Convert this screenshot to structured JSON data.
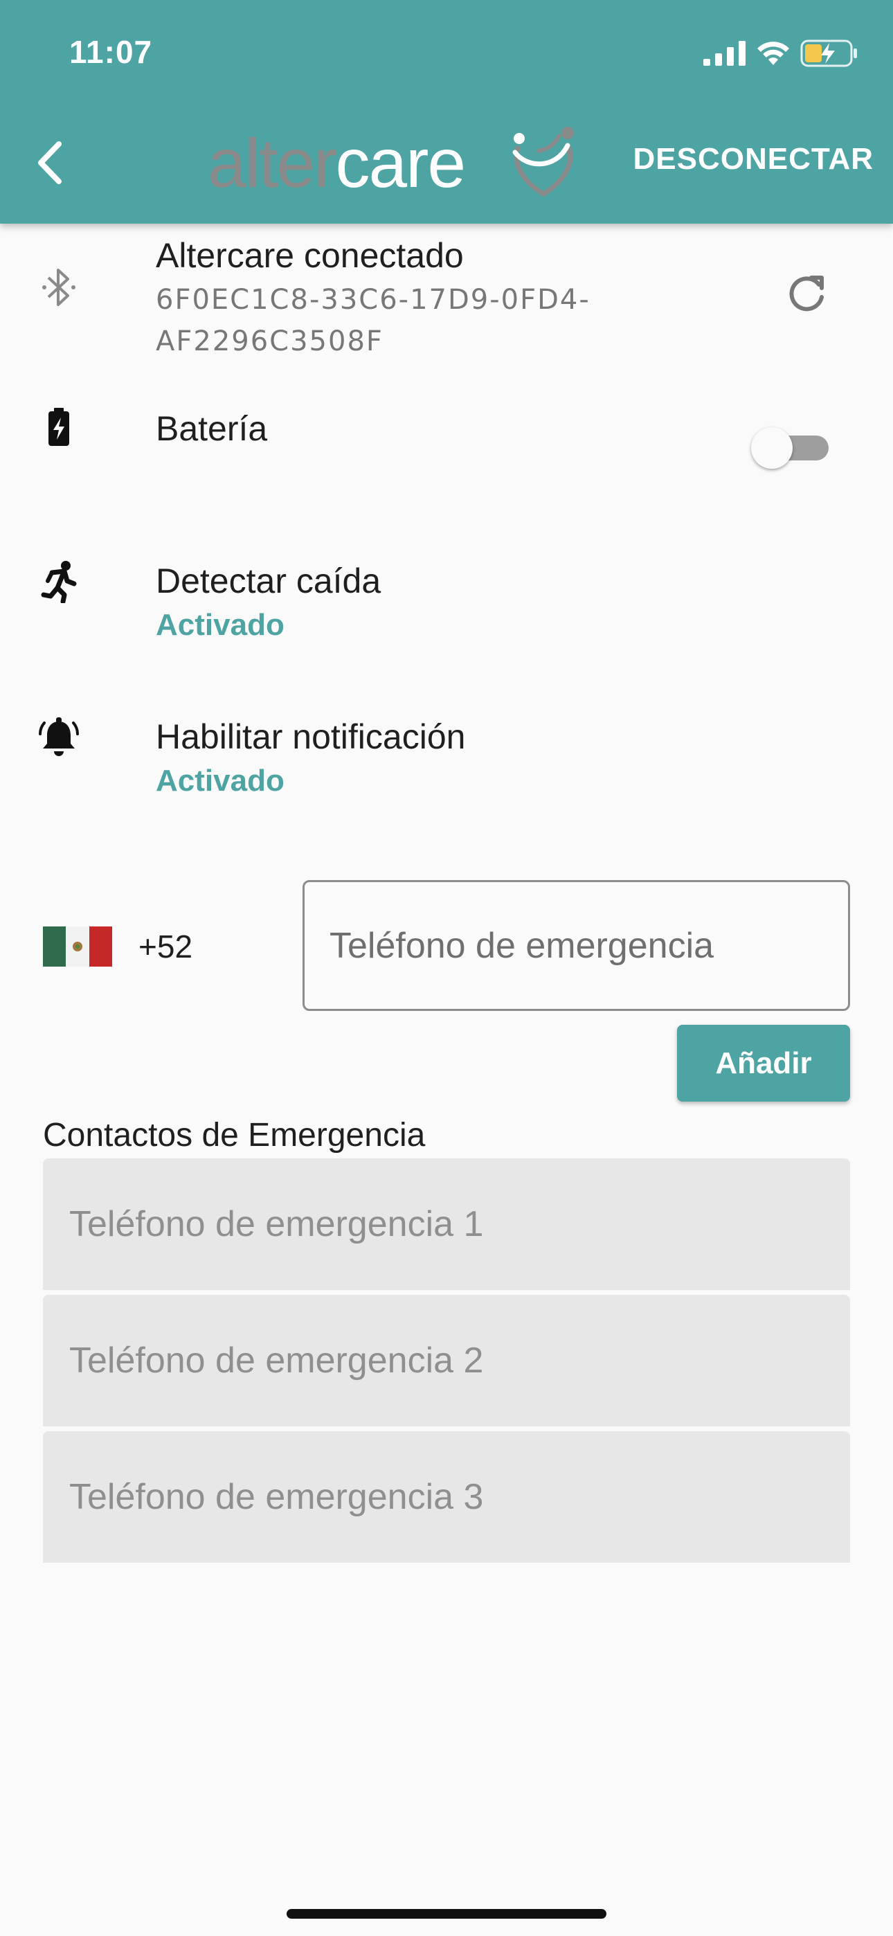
{
  "status_bar": {
    "time": "11:07",
    "icons": [
      "signal-icon",
      "wifi-icon",
      "battery-charging-icon"
    ]
  },
  "app_bar": {
    "back_icon": "chevron-left-icon",
    "logo": {
      "part1": "alter",
      "part2": "care"
    },
    "disconnect_label": "DESCONECTAR",
    "background_color": "#4ea3a3"
  },
  "device": {
    "icon": "bluetooth-icon",
    "title": "Altercare conectado",
    "id": "6F0EC1C8-33C6-17D9-0FD4-AF2296C3508F",
    "refresh_icon": "refresh-icon"
  },
  "battery": {
    "icon": "battery-charging-icon",
    "title": "Batería",
    "toggle_on": false
  },
  "fall_detection": {
    "icon": "running-person-icon",
    "title": "Detectar caída",
    "status": "Activado"
  },
  "notifications": {
    "icon": "alarm-bell-icon",
    "title": "Habilitar notificación",
    "status": "Activado"
  },
  "phone_entry": {
    "flag_icon": "mexico-flag-icon",
    "dial_code": "+52",
    "placeholder": "Teléfono de emergencia",
    "add_label": "Añadir"
  },
  "contacts": {
    "title": "Contactos de Emergencia",
    "items": [
      {
        "placeholder": "Teléfono de emergencia 1"
      },
      {
        "placeholder": "Teléfono de emergencia 2"
      },
      {
        "placeholder": "Teléfono de emergencia 3"
      }
    ]
  },
  "colors": {
    "accent": "#4ea3a3",
    "field_background": "#e7e7e7"
  }
}
